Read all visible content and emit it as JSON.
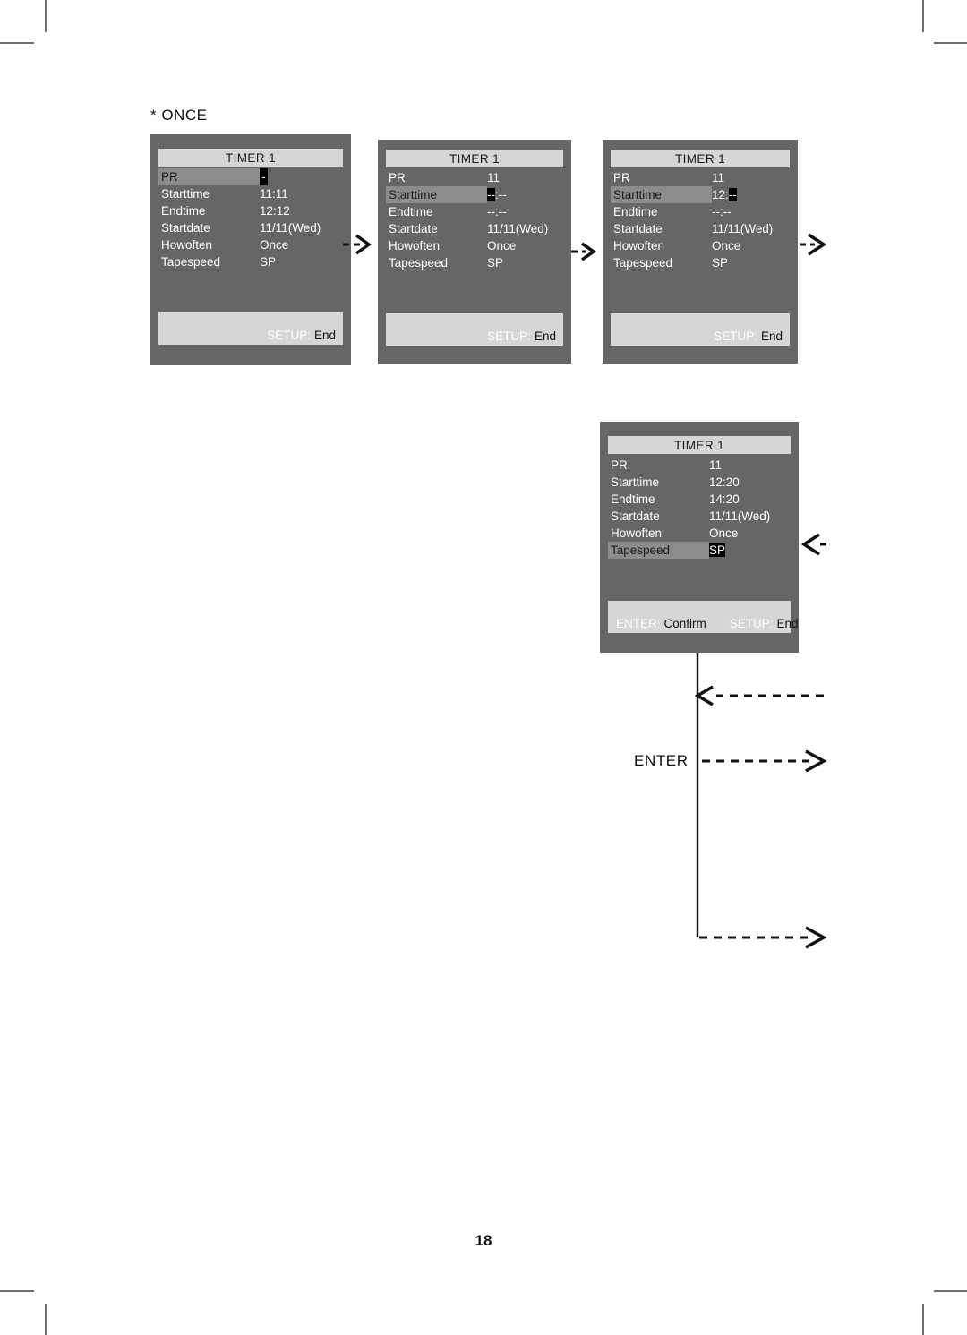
{
  "page": {
    "heading": "* ONCE",
    "number": "18",
    "enter_label": "ENTER"
  },
  "panels": [
    {
      "id": "panel-1",
      "title": "TIMER 1",
      "rows": [
        {
          "label": "PR",
          "selected": true,
          "value_pre": "",
          "value_hl": "-",
          "value_post": ""
        },
        {
          "label": "Starttime",
          "selected": false,
          "value_pre": "11:11",
          "value_hl": "",
          "value_post": ""
        },
        {
          "label": "Endtime",
          "selected": false,
          "value_pre": "12:12",
          "value_hl": "",
          "value_post": ""
        },
        {
          "label": "Startdate",
          "selected": false,
          "value_pre": "11/11(Wed)",
          "value_hl": "",
          "value_post": ""
        },
        {
          "label": "Howoften",
          "selected": false,
          "value_pre": "Once",
          "value_hl": "",
          "value_post": ""
        },
        {
          "label": "Tapespeed",
          "selected": false,
          "value_pre": "SP",
          "value_hl": "",
          "value_post": ""
        }
      ],
      "footer": [
        {
          "key": "SETUP:",
          "action": "End"
        }
      ]
    },
    {
      "id": "panel-2",
      "title": "TIMER 1",
      "rows": [
        {
          "label": "PR",
          "selected": false,
          "value_pre": "11",
          "value_hl": "",
          "value_post": ""
        },
        {
          "label": "Starttime",
          "selected": true,
          "value_pre": "",
          "value_hl": "--",
          "value_post": ":--"
        },
        {
          "label": "Endtime",
          "selected": false,
          "value_pre": "--:--",
          "value_hl": "",
          "value_post": ""
        },
        {
          "label": "Startdate",
          "selected": false,
          "value_pre": "11/11(Wed)",
          "value_hl": "",
          "value_post": ""
        },
        {
          "label": "Howoften",
          "selected": false,
          "value_pre": "Once",
          "value_hl": "",
          "value_post": ""
        },
        {
          "label": "Tapespeed",
          "selected": false,
          "value_pre": "SP",
          "value_hl": "",
          "value_post": ""
        }
      ],
      "footer": [
        {
          "key": "SETUP:",
          "action": "End"
        }
      ]
    },
    {
      "id": "panel-3",
      "title": "TIMER 1",
      "rows": [
        {
          "label": "PR",
          "selected": false,
          "value_pre": "11",
          "value_hl": "",
          "value_post": ""
        },
        {
          "label": "Starttime",
          "selected": true,
          "value_pre": "12:",
          "value_hl": "--",
          "value_post": ""
        },
        {
          "label": "Endtime",
          "selected": false,
          "value_pre": "--:--",
          "value_hl": "",
          "value_post": ""
        },
        {
          "label": "Startdate",
          "selected": false,
          "value_pre": "11/11(Wed)",
          "value_hl": "",
          "value_post": ""
        },
        {
          "label": "Howoften",
          "selected": false,
          "value_pre": "Once",
          "value_hl": "",
          "value_post": ""
        },
        {
          "label": "Tapespeed",
          "selected": false,
          "value_pre": "SP",
          "value_hl": "",
          "value_post": ""
        }
      ],
      "footer": [
        {
          "key": "SETUP:",
          "action": "End"
        }
      ]
    },
    {
      "id": "panel-4",
      "title": "TIMER 1",
      "rows": [
        {
          "label": "PR",
          "selected": false,
          "value_pre": "11",
          "value_hl": "",
          "value_post": ""
        },
        {
          "label": "Starttime",
          "selected": false,
          "value_pre": "12:20",
          "value_hl": "",
          "value_post": ""
        },
        {
          "label": "Endtime",
          "selected": false,
          "value_pre": "14:20",
          "value_hl": "",
          "value_post": ""
        },
        {
          "label": "Startdate",
          "selected": false,
          "value_pre": "11/11(Wed)",
          "value_hl": "",
          "value_post": ""
        },
        {
          "label": "Howoften",
          "selected": false,
          "value_pre": "Once",
          "value_hl": "",
          "value_post": ""
        },
        {
          "label": "Tapespeed",
          "selected": true,
          "value_pre": "",
          "value_hl": "SP",
          "value_post": ""
        }
      ],
      "footer": [
        {
          "key": "ENTER:",
          "action": "Confirm"
        },
        {
          "key": "SETUP:",
          "action": "End"
        }
      ]
    }
  ],
  "colors": {
    "panel_bg": "#666666",
    "bar_light": "#d6d6d6",
    "row_selected": "#8c8c8c",
    "highlight": "#000000",
    "text_light": "#ffffff",
    "text_dark": "#111111"
  }
}
